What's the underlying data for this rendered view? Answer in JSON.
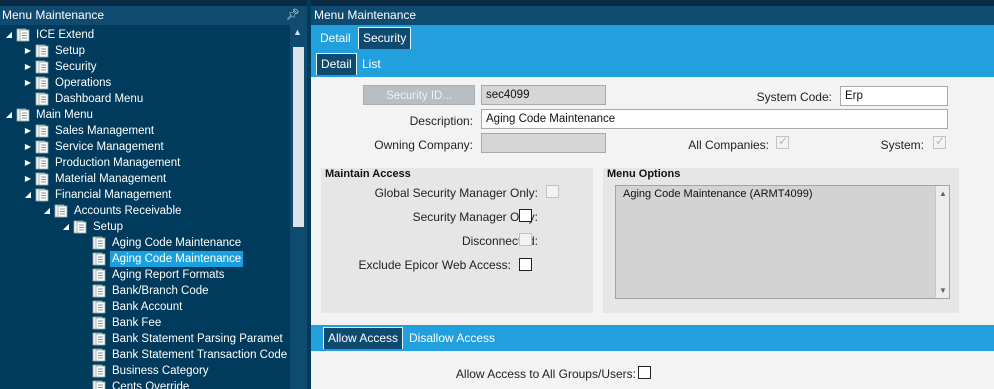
{
  "left_panel": {
    "title": "Menu Maintenance",
    "pin_icon": "pin-icon",
    "tree": [
      {
        "label": "ICE Extend",
        "level": 0,
        "expander": "expanded"
      },
      {
        "label": "Setup",
        "level": 1,
        "expander": "collapsed"
      },
      {
        "label": "Security",
        "level": 1,
        "expander": "collapsed"
      },
      {
        "label": "Operations",
        "level": 1,
        "expander": "collapsed"
      },
      {
        "label": "Dashboard Menu",
        "level": 1,
        "expander": "none"
      },
      {
        "label": "Main Menu",
        "level": 0,
        "expander": "expanded"
      },
      {
        "label": "Sales Management",
        "level": 1,
        "expander": "collapsed"
      },
      {
        "label": "Service Management",
        "level": 1,
        "expander": "collapsed"
      },
      {
        "label": "Production Management",
        "level": 1,
        "expander": "collapsed"
      },
      {
        "label": "Material Management",
        "level": 1,
        "expander": "collapsed"
      },
      {
        "label": "Financial Management",
        "level": 1,
        "expander": "expanded"
      },
      {
        "label": "Accounts Receivable",
        "level": 2,
        "expander": "expanded"
      },
      {
        "label": "Setup",
        "level": 3,
        "expander": "expanded"
      },
      {
        "label": "Aging Code Maintenance",
        "level": 4,
        "expander": "none"
      },
      {
        "label": "Aging Code Maintenance",
        "level": 4,
        "expander": "none",
        "selected": true
      },
      {
        "label": "Aging Report Formats",
        "level": 4,
        "expander": "none"
      },
      {
        "label": "Bank/Branch Code",
        "level": 4,
        "expander": "none"
      },
      {
        "label": "Bank Account",
        "level": 4,
        "expander": "none"
      },
      {
        "label": "Bank Fee",
        "level": 4,
        "expander": "none"
      },
      {
        "label": "Bank Statement Parsing Paramet",
        "level": 4,
        "expander": "none"
      },
      {
        "label": "Bank Statement Transaction Code",
        "level": 4,
        "expander": "none"
      },
      {
        "label": "Business Category",
        "level": 4,
        "expander": "none"
      },
      {
        "label": "Cents Override",
        "level": 4,
        "expander": "none"
      }
    ]
  },
  "right_panel": {
    "title": "Menu Maintenance",
    "main_tabs": [
      {
        "label": "Detail",
        "active": false
      },
      {
        "label": "Security",
        "active": true
      }
    ],
    "sub_tabs": [
      {
        "label": "Detail",
        "active": true
      },
      {
        "label": "List",
        "active": false
      }
    ],
    "form": {
      "security_id_button": "Security ID...",
      "security_id_value": "sec4099",
      "system_code_label": "System Code:",
      "system_code_value": "Erp",
      "description_label": "Description:",
      "description_value": "Aging Code Maintenance",
      "owning_company_label": "Owning Company:",
      "owning_company_value": "",
      "all_companies_label": "All Companies:",
      "all_companies_checked": true,
      "system_label": "System:",
      "system_checked": true
    },
    "maintain_access": {
      "title": "Maintain Access",
      "global_security_manager_only": {
        "label": "Global Security Manager Only:",
        "checked": false,
        "enabled": false
      },
      "security_manager_only": {
        "label": "Security Manager Only:",
        "checked": false,
        "enabled": true
      },
      "disconnected": {
        "label": "Disconnected:",
        "checked": false,
        "enabled": false
      },
      "exclude_epicor_web_access": {
        "label": "Exclude Epicor Web Access:",
        "checked": false,
        "enabled": true
      }
    },
    "menu_options": {
      "title": "Menu Options",
      "items": [
        "Aging Code Maintenance (ARMT4099)"
      ]
    },
    "access_tabs": [
      {
        "label": "Allow Access",
        "active": true
      },
      {
        "label": "Disallow Access",
        "active": false
      }
    ],
    "allow_all_label": "Allow Access to All Groups/Users:",
    "allow_all_checked": false
  },
  "colors": {
    "tree_bg": "#003a5c",
    "header_bg": "#0f4b70",
    "tab_strip": "#22a0dd",
    "selection": "#1aa0dc"
  }
}
